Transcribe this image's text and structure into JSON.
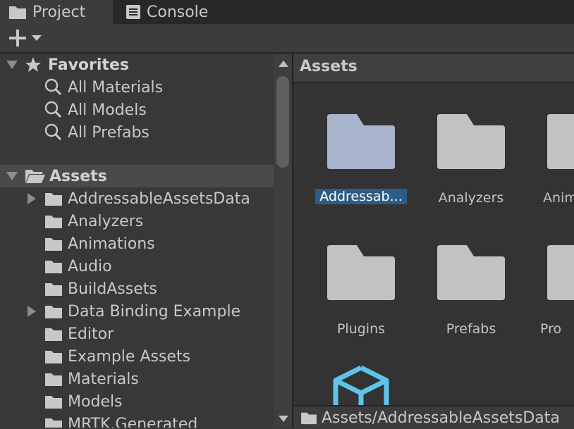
{
  "tabs": [
    {
      "label": "Project",
      "icon": "folder-icon",
      "active": true
    },
    {
      "label": "Console",
      "icon": "console-icon",
      "active": false
    }
  ],
  "toolbar": {
    "create_icon": "plus-icon",
    "create_dropdown_icon": "chevron-down-icon"
  },
  "favorites": {
    "title": "Favorites",
    "items": [
      "All Materials",
      "All Models",
      "All Prefabs"
    ]
  },
  "assets_tree": {
    "title": "Assets",
    "items": [
      {
        "label": "AddressableAssetsData",
        "expandable": true
      },
      {
        "label": "Analyzers",
        "expandable": false
      },
      {
        "label": "Animations",
        "expandable": false
      },
      {
        "label": "Audio",
        "expandable": false
      },
      {
        "label": "BuildAssets",
        "expandable": false
      },
      {
        "label": "Data Binding Example",
        "expandable": true
      },
      {
        "label": "Editor",
        "expandable": false
      },
      {
        "label": "Example Assets",
        "expandable": false
      },
      {
        "label": "Materials",
        "expandable": false
      },
      {
        "label": "Models",
        "expandable": false
      },
      {
        "label": "MRTK.Generated",
        "expandable": false
      }
    ]
  },
  "content": {
    "header": "Assets",
    "items": [
      {
        "label": "Addressab...",
        "selected": true
      },
      {
        "label": "Analyzers",
        "selected": false
      },
      {
        "label": "Anim",
        "selected": false
      },
      {
        "label": "Plugins",
        "selected": false
      },
      {
        "label": "Prefabs",
        "selected": false
      },
      {
        "label": "Pro",
        "selected": false
      }
    ]
  },
  "status": {
    "path": "Assets/AddressableAssetsData"
  },
  "colors": {
    "selected_folder": "#a8b4cc",
    "folder": "#c2c2c2",
    "selection_highlight": "#2c5d87",
    "prefab_icon": "#5fc3ea"
  }
}
